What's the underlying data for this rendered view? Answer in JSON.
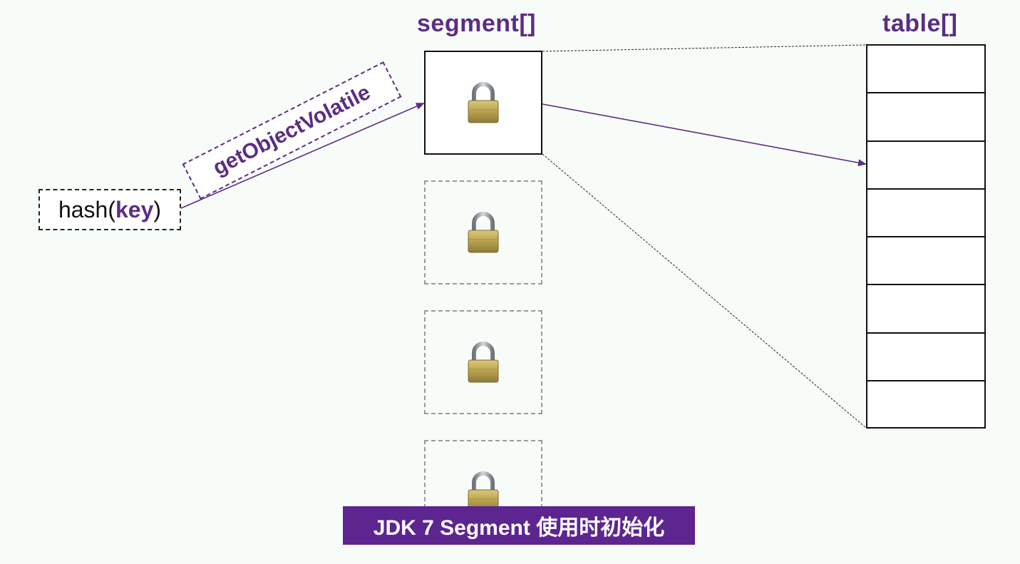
{
  "titles": {
    "segment": "segment[]",
    "table": "table[]"
  },
  "hash_label": {
    "prefix": "hash(",
    "key": "key",
    "suffix": ")"
  },
  "method_label": "getObjectVolatile",
  "segments": [
    {
      "state": "initialized",
      "icon": "lock-icon"
    },
    {
      "state": "uninitialized",
      "icon": "lock-icon"
    },
    {
      "state": "uninitialized",
      "icon": "lock-icon"
    },
    {
      "state": "uninitialized",
      "icon": "lock-icon"
    }
  ],
  "table_slot_count": 8,
  "caption": "JDK 7 Segment 使用时初始化",
  "colors": {
    "accent_purple": "#5b2d86",
    "caption_bg": "#5c2590",
    "active_border": "#111111",
    "inactive_border": "#9a9a9a",
    "lock_body": "#b9a24f",
    "lock_shackle": "#9ca0a6"
  }
}
